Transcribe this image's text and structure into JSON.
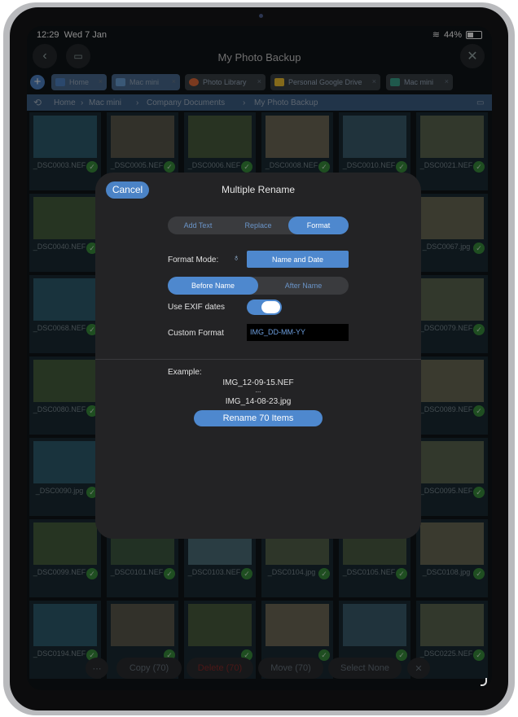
{
  "status": {
    "time": "12:29",
    "date": "Wed 7 Jan",
    "battery": "44%",
    "battery_level": 0.44
  },
  "nav": {
    "title": "My Photo Backup",
    "back_icon": "chevron-left-icon",
    "sidebar_icon": "sidebar-icon",
    "close_icon": "close-icon"
  },
  "tabs": [
    {
      "label": "Home",
      "icon": "folder-icon",
      "color": "#4f83c6"
    },
    {
      "label": "Mac mini",
      "icon": "monitor-icon",
      "color": "#6aa0d8"
    },
    {
      "label": "Photo Library",
      "icon": "photos-icon",
      "color": "#e06a3a"
    },
    {
      "label": "Personal Google Drive",
      "icon": "google-drive-icon",
      "color": "#f1c232"
    },
    {
      "label": "Mac mini",
      "icon": "monitor-icon",
      "color": "#3aa38a"
    }
  ],
  "breadcrumb": [
    "Home",
    "Mac mini",
    "Company Documents",
    "My Photo Backup"
  ],
  "files": [
    "_DSC0003.NEF",
    "_DSC0005.NEF",
    "_DSC0006.NEF",
    "_DSC0008.NEF",
    "_DSC0010.NEF",
    "_DSC0021.NEF",
    "_DSC0040.NEF",
    "",
    "",
    "",
    "",
    "_DSC0067.jpg",
    "_DSC0068.NEF",
    "",
    "",
    "",
    "",
    "_DSC0079.NEF",
    "_DSC0080.NEF",
    "",
    "",
    "",
    "",
    "_DSC0089.NEF",
    "_DSC0090.jpg",
    "",
    "",
    "",
    "",
    "_DSC0095.NEF",
    "_DSC0099.NEF",
    "_DSC0101.NEF",
    "_DSC0103.NEF",
    "_DSC0104.jpg",
    "_DSC0105.NEF",
    "_DSC0108.jpg",
    "_DSC0194.NEF",
    "",
    "",
    "",
    "",
    "_DSC0225.NEF"
  ],
  "modal": {
    "cancel": "Cancel",
    "title": "Multiple Rename",
    "mode_tabs": [
      "Add Text",
      "Replace",
      "Format"
    ],
    "selected_mode": "Format",
    "format_mode_label": "Format Mode:",
    "format_mode_value": "Name and Date",
    "position_tabs": [
      "Before Name",
      "After Name"
    ],
    "selected_position": "Before Name",
    "exif_label": "Use EXIF dates",
    "exif_on": true,
    "custom_format_label": "Custom Format",
    "custom_format_value": "IMG_DD-MM-YY",
    "example_label": "Example:",
    "example_first": "IMG_12-09-15.NEF",
    "example_ellipsis": "...",
    "example_last": "IMG_14-08-23.jpg",
    "rename_button": "Rename 70 Items"
  },
  "toolbar": {
    "copy": "Copy (70)",
    "delete": "Delete (70)",
    "move": "Move (70)",
    "select_none": "Select None",
    "delete_color": "#8a2a2a"
  }
}
